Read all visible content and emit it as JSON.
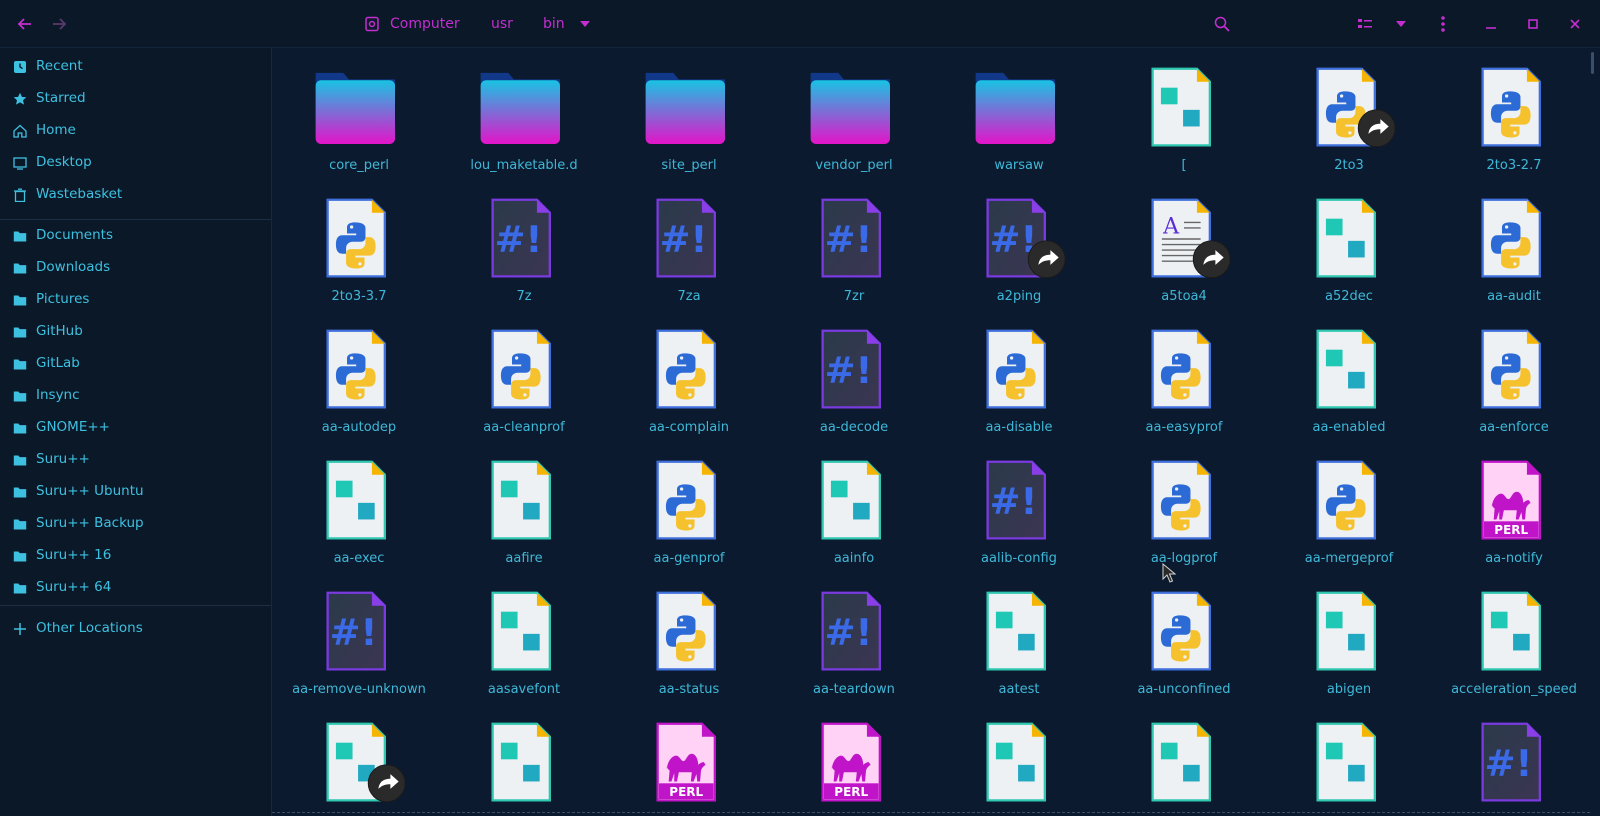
{
  "colors": {
    "accent": "#c42ed0",
    "text": "#3fb8d8",
    "background": "#0b1a2e",
    "sidebar": "#0a1828"
  },
  "header": {
    "nav_back_icon": "arrow-left",
    "nav_forward_icon": "arrow-right",
    "breadcrumb": {
      "root_icon": "drive-icon",
      "items": [
        "Computer",
        "usr",
        "bin"
      ]
    },
    "search_icon": "search",
    "view_icon": "list-view",
    "menu_icon": "kebab-menu",
    "window": {
      "minimize_icon": "minimize",
      "maximize_icon": "maximize",
      "close_icon": "close"
    }
  },
  "sidebar": {
    "places": [
      {
        "label": "Recent",
        "icon": "clock-icon"
      },
      {
        "label": "Starred",
        "icon": "star-icon"
      },
      {
        "label": "Home",
        "icon": "home-icon"
      },
      {
        "label": "Desktop",
        "icon": "desktop-icon"
      },
      {
        "label": "Wastebasket",
        "icon": "trash-icon"
      }
    ],
    "bookmarks": [
      {
        "label": "Documents",
        "icon": "folder-icon"
      },
      {
        "label": "Downloads",
        "icon": "folder-icon"
      },
      {
        "label": "Pictures",
        "icon": "folder-icon"
      },
      {
        "label": "GitHub",
        "icon": "folder-icon"
      },
      {
        "label": "GitLab",
        "icon": "folder-icon"
      },
      {
        "label": "Insync",
        "icon": "folder-icon"
      },
      {
        "label": "GNOME++",
        "icon": "folder-icon"
      },
      {
        "label": "Suru++",
        "icon": "folder-icon"
      },
      {
        "label": "Suru++ Ubuntu",
        "icon": "folder-icon"
      },
      {
        "label": "Suru++ Backup",
        "icon": "folder-icon"
      },
      {
        "label": "Suru++ 16",
        "icon": "folder-icon"
      },
      {
        "label": "Suru++ 64",
        "icon": "folder-icon"
      }
    ],
    "other": {
      "label": "Other Locations",
      "icon": "plus-icon"
    }
  },
  "files": [
    {
      "name": "core_perl",
      "type": "folder",
      "link": false
    },
    {
      "name": "lou_maketable.d",
      "type": "folder",
      "link": false
    },
    {
      "name": "site_perl",
      "type": "folder",
      "link": false
    },
    {
      "name": "vendor_perl",
      "type": "folder",
      "link": false
    },
    {
      "name": "warsaw",
      "type": "folder",
      "link": false
    },
    {
      "name": "[",
      "type": "binary",
      "link": false
    },
    {
      "name": "2to3",
      "type": "python",
      "link": true
    },
    {
      "name": "2to3-2.7",
      "type": "python",
      "link": false
    },
    {
      "name": "2to3-3.7",
      "type": "python",
      "link": false
    },
    {
      "name": "7z",
      "type": "script",
      "link": false
    },
    {
      "name": "7za",
      "type": "script",
      "link": false
    },
    {
      "name": "7zr",
      "type": "script",
      "link": false
    },
    {
      "name": "a2ping",
      "type": "script",
      "link": true
    },
    {
      "name": "a5toa4",
      "type": "text",
      "link": true
    },
    {
      "name": "a52dec",
      "type": "binary",
      "link": false
    },
    {
      "name": "aa-audit",
      "type": "python",
      "link": false
    },
    {
      "name": "aa-autodep",
      "type": "python",
      "link": false
    },
    {
      "name": "aa-cleanprof",
      "type": "python",
      "link": false
    },
    {
      "name": "aa-complain",
      "type": "python",
      "link": false
    },
    {
      "name": "aa-decode",
      "type": "script",
      "link": false
    },
    {
      "name": "aa-disable",
      "type": "python",
      "link": false
    },
    {
      "name": "aa-easyprof",
      "type": "python",
      "link": false
    },
    {
      "name": "aa-enabled",
      "type": "binary",
      "link": false
    },
    {
      "name": "aa-enforce",
      "type": "python",
      "link": false
    },
    {
      "name": "aa-exec",
      "type": "binary",
      "link": false
    },
    {
      "name": "aafire",
      "type": "binary",
      "link": false
    },
    {
      "name": "aa-genprof",
      "type": "python",
      "link": false
    },
    {
      "name": "aainfo",
      "type": "binary",
      "link": false
    },
    {
      "name": "aalib-config",
      "type": "script",
      "link": false
    },
    {
      "name": "aa-logprof",
      "type": "python",
      "link": false
    },
    {
      "name": "aa-mergeprof",
      "type": "python",
      "link": false
    },
    {
      "name": "aa-notify",
      "type": "perl",
      "link": false
    },
    {
      "name": "aa-remove-unknown",
      "type": "script",
      "link": false
    },
    {
      "name": "aasavefont",
      "type": "binary",
      "link": false
    },
    {
      "name": "aa-status",
      "type": "python",
      "link": false
    },
    {
      "name": "aa-teardown",
      "type": "script",
      "link": false
    },
    {
      "name": "aatest",
      "type": "binary",
      "link": false
    },
    {
      "name": "aa-unconfined",
      "type": "python",
      "link": false
    },
    {
      "name": "abigen",
      "type": "binary",
      "link": false
    },
    {
      "name": "acceleration_speed",
      "type": "binary",
      "link": false
    },
    {
      "name": "",
      "type": "binary",
      "link": true
    },
    {
      "name": "",
      "type": "binary",
      "link": false
    },
    {
      "name": "",
      "type": "perl",
      "link": false
    },
    {
      "name": "",
      "type": "perl",
      "link": false
    },
    {
      "name": "",
      "type": "binary",
      "link": false
    },
    {
      "name": "",
      "type": "binary",
      "link": false
    },
    {
      "name": "",
      "type": "binary",
      "link": false
    },
    {
      "name": "",
      "type": "script",
      "link": false
    }
  ],
  "perl_badge": "PERL"
}
